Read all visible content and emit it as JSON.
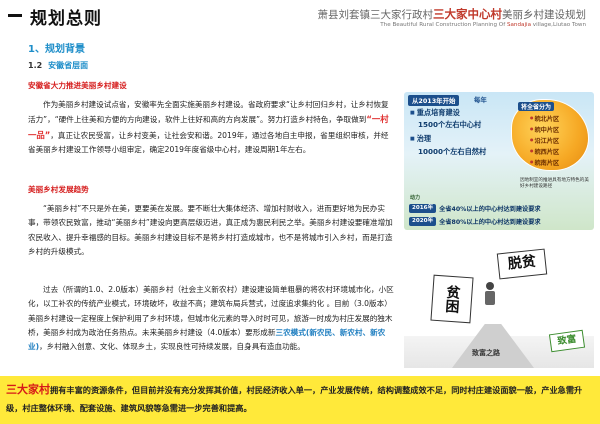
{
  "header": {
    "title": "规划总则",
    "project_pre": "萧县刘套镇三大家行政村",
    "project_hl": "三大家中心村",
    "project_post": "美丽乡村建设规划",
    "project_en_pre": "The Beautiful Rural Construction Planning Of ",
    "project_en_hl": "Sandajia",
    "project_en_post": " village,Liutao Town"
  },
  "section": {
    "h1": "1、规划背景",
    "h2_num": "1.2",
    "h2_text": "安徽省层面"
  },
  "block1": {
    "heading": "安徽省大力推进美丽乡村建设",
    "p1": "作为美丽乡村建设试点省，安徽率先全面实施美丽乡村建设。省政府要求“让乡村回归乡村，让乡村恢复活力”，“硬件上往美和方便的方向建设，软件上往好和高的方向发展”。努力打造乡村特色，争取做到",
    "p1_em": "“一村一品”",
    "p1_post": "，真正让农民受富，让乡村变美，让社会安和谐。2019年，通过各地自主申报，省里组织审核，并经省美丽乡村建设工作领导小组审定，确定2019年度省级中心村，建设周期1年左右。"
  },
  "block2": {
    "heading": "美丽乡村发展趋势",
    "p1": "“美丽乡村”不只是外在美，更要美在发展。要不断壮大集体经济、增加村财收入，进而更好地为民办实事，带领农民致富，推动“美丽乡村”建设向更高层级迈进，真正成为惠民利民之举。美丽乡村建设要確准增加农民收入、提升幸福感的目标。美丽乡村建设目标不是将乡村打造成城市，也不是将城市引入乡村，而是打造乡村的升级模式。",
    "p2": "过去（所谓的1.0、2.0版本）美丽乡村（社会主义新农村）建设建设简单粗暴的将农村环境城市化，小区化，以工补农的传统产业模式，环境破坏，收益不高；建筑布局兵营式，过度追求集约化 。目前（3.0版本）美丽乡村建设一定程度上保护利用了乡村环境，但城市化元素的导入时时可见，旅游一时成为村庄发展的独木桥，美丽乡村成为政治任务热点。未来美丽乡村建设（4.0版本）要形成新",
    "p2_em": "三农模式(新农民、新农村、新农业)",
    "p2_post": "，乡村融入创意、文化、体现乡土，实现良性可持续发展，自身具有造血功能。"
  },
  "infographic": {
    "title": "从2013年开始",
    "title2": "每年",
    "items": [
      "重点培育建设",
      "1500个左右中心村",
      "治理",
      "10000个左右自然村"
    ],
    "map_title": "将全省分为",
    "regions": [
      "皖北片区",
      "皖中片区",
      "沿江片区",
      "皖西片区",
      "皖南片区"
    ],
    "note": "因地制宜的推进具有地方特色的美好乡村建设路径",
    "power": "动力",
    "years": [
      {
        "year": "2016年",
        "text": "全省40%以上的中心村达到建设要求"
      },
      {
        "year": "2020年",
        "text": "全省80%以上的中心村达到建设要求"
      }
    ]
  },
  "illustration": {
    "sign_top": "脱贫",
    "sign_left": "贫困",
    "road": "致富之路",
    "sign_right": "致富"
  },
  "banner": {
    "hl": "三大家村",
    "text": "拥有丰富的资源条件，但目前并没有充分发挥其价值，村民经济收入单一，产业发展传统，结构调整成效不足，同时村庄建设面貌一般，产业急需升级，村庄整体环境、配套设施、建筑风貌等急需进一步完善和提高。"
  },
  "colors": {
    "accent_blue": "#1e8ec9",
    "heading_red": "#d62020",
    "banner_yellow": "#ffe93a"
  }
}
